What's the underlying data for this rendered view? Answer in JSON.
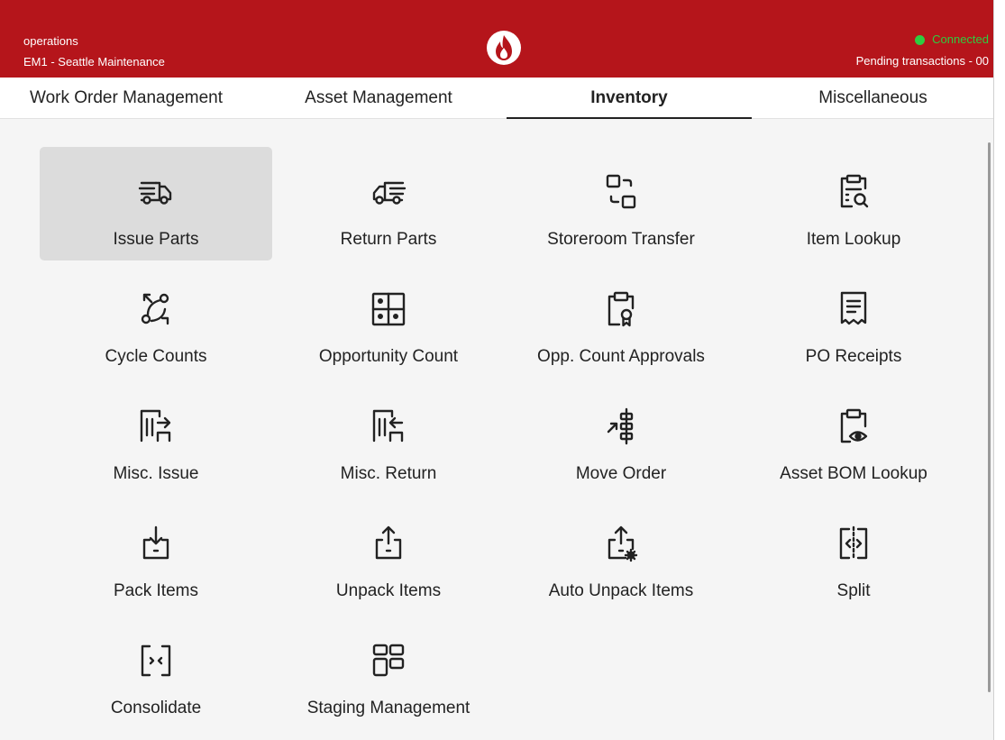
{
  "header": {
    "context": "operations",
    "location": "EM1 - Seattle Maintenance",
    "connection_status": "Connected",
    "connection_color": "#2ecc40",
    "pending_transactions": "Pending transactions - 00",
    "brand_color": "#b5151b"
  },
  "tabs": [
    {
      "label": "Work Order Management",
      "active": false
    },
    {
      "label": "Asset Management",
      "active": false
    },
    {
      "label": "Inventory",
      "active": true
    },
    {
      "label": "Miscellaneous",
      "active": false
    }
  ],
  "menu": {
    "items": [
      {
        "label": "Issue Parts",
        "icon": "truck-icon",
        "selected": true
      },
      {
        "label": "Return Parts",
        "icon": "truck-reverse-icon",
        "selected": false
      },
      {
        "label": "Storeroom Transfer",
        "icon": "transfer-icon",
        "selected": false
      },
      {
        "label": "Item Lookup",
        "icon": "clipboard-search-icon",
        "selected": false
      },
      {
        "label": "Cycle Counts",
        "icon": "cycle-icon",
        "selected": false
      },
      {
        "label": "Opportunity Count",
        "icon": "grid-dots-icon",
        "selected": false
      },
      {
        "label": "Opp. Count Approvals",
        "icon": "clipboard-badge-icon",
        "selected": false
      },
      {
        "label": "PO Receipts",
        "icon": "receipt-icon",
        "selected": false
      },
      {
        "label": "Misc. Issue",
        "icon": "shelf-out-icon",
        "selected": false
      },
      {
        "label": "Misc. Return",
        "icon": "shelf-in-icon",
        "selected": false
      },
      {
        "label": "Move Order",
        "icon": "move-order-icon",
        "selected": false
      },
      {
        "label": "Asset BOM Lookup",
        "icon": "clipboard-eye-icon",
        "selected": false
      },
      {
        "label": "Pack Items",
        "icon": "pack-icon",
        "selected": false
      },
      {
        "label": "Unpack Items",
        "icon": "unpack-icon",
        "selected": false
      },
      {
        "label": "Auto Unpack Items",
        "icon": "auto-unpack-icon",
        "selected": false
      },
      {
        "label": "Split",
        "icon": "split-icon",
        "selected": false
      },
      {
        "label": "Consolidate",
        "icon": "consolidate-icon",
        "selected": false
      },
      {
        "label": "Staging Management",
        "icon": "staging-grid-icon",
        "selected": false
      }
    ]
  }
}
